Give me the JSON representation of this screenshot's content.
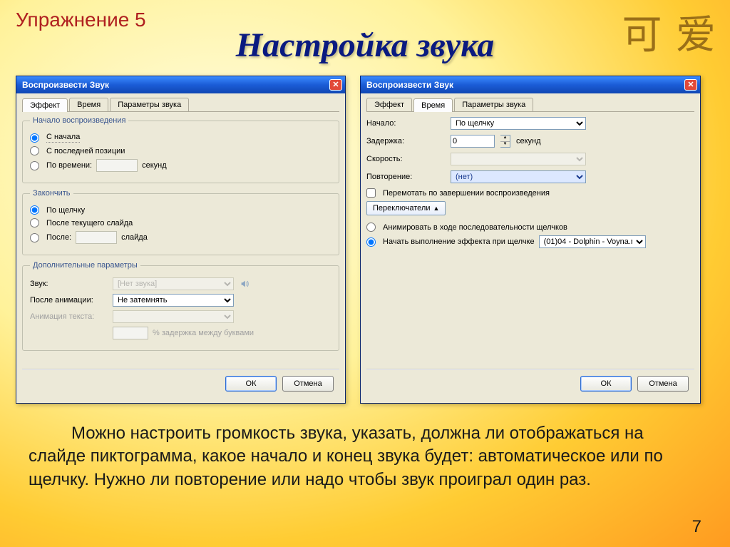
{
  "slide": {
    "exercise_label": "Упражнение 5",
    "title": "Настройка звука",
    "kanji": "可 爱",
    "body_text": "Можно настроить громкость звука, указать, должна ли отображаться на слайде пиктограмма, какое начало и конец звука будет: автоматическое или по щелчку. Нужно ли повторение или надо чтобы звук проиграл один раз.",
    "page_number": "7"
  },
  "dialog1": {
    "title": "Воспроизвести Звук",
    "tabs": {
      "t1": "Эффект",
      "t2": "Время",
      "t3": "Параметры звука"
    },
    "group_start": "Начало воспроизведения",
    "start_begin": "С начала",
    "start_last": "С последней позиции",
    "start_time": "По времени:",
    "seconds": "секунд",
    "group_stop": "Закончить",
    "stop_click": "По щелчку",
    "stop_after_slide": "После текущего слайда",
    "stop_after": "После:",
    "slide_unit": "слайда",
    "group_extra": "Дополнительные параметры",
    "sound_label": "Звук:",
    "sound_value": "[Нет звука]",
    "after_anim_label": "После анимации:",
    "after_anim_value": "Не затемнять",
    "text_anim_label": "Анимация текста:",
    "delay_letters": "% задержка между буквами",
    "ok": "ОК",
    "cancel": "Отмена"
  },
  "dialog2": {
    "title": "Воспроизвести Звук",
    "tabs": {
      "t1": "Эффект",
      "t2": "Время",
      "t3": "Параметры звука"
    },
    "start_label": "Начало:",
    "start_value": "По щелчку",
    "delay_label": "Задержка:",
    "delay_value": "0",
    "seconds": "секунд",
    "speed_label": "Скорость:",
    "repeat_label": "Повторение:",
    "repeat_value": "(нет)",
    "rewind_label": "Перемотать по завершении воспроизведения",
    "toggles": "Переключатели",
    "seq_label": "Анимировать в ходе последовательности щелчков",
    "start_effect_label": "Начать выполнение эффекта при щелчке",
    "start_effect_value": "(01)04 - Dolphin - Voyna.m",
    "ok": "ОК",
    "cancel": "Отмена"
  }
}
